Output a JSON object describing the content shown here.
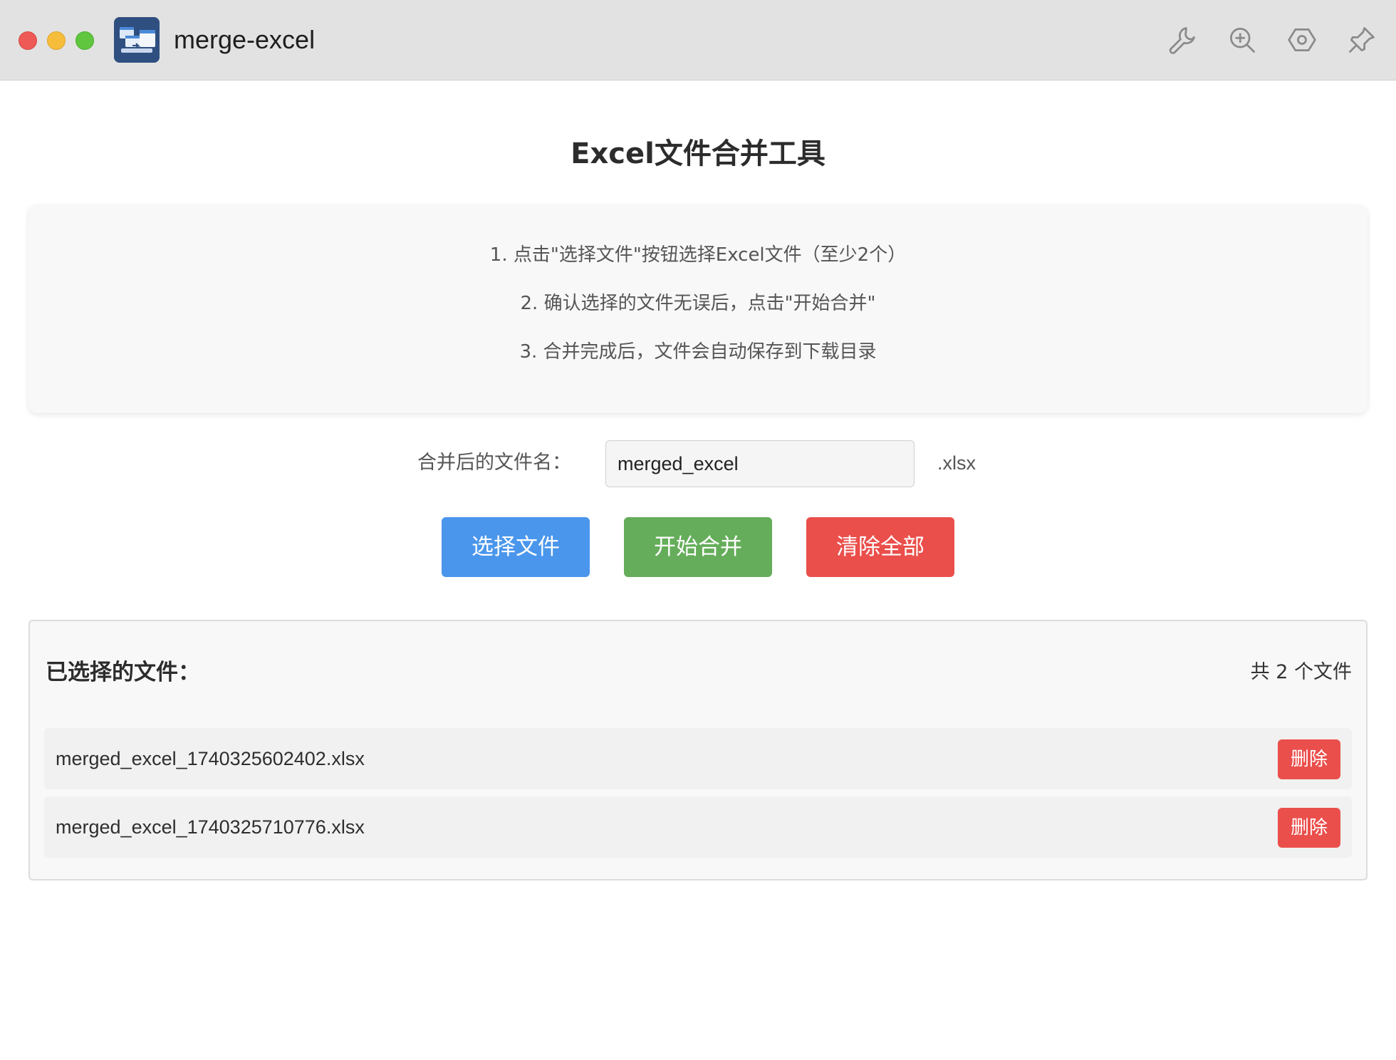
{
  "window": {
    "app_title": "merge-excel"
  },
  "main": {
    "page_title": "Excel文件合并工具",
    "instructions": [
      "1. 点击\"选择文件\"按钮选择Excel文件（至少2个）",
      "2. 确认选择的文件无误后，点击\"开始合并\"",
      "3. 合并完成后，文件会自动保存到下载目录"
    ],
    "filename": {
      "label": "合并后的文件名：",
      "value": "merged_excel",
      "extension": ".xlsx"
    },
    "buttons": {
      "select": "选择文件",
      "merge": "开始合并",
      "clear": "清除全部"
    },
    "files": {
      "heading": "已选择的文件：",
      "count": "共 2 个文件",
      "items": [
        {
          "name": "merged_excel_1740325602402.xlsx",
          "delete_label": "删除"
        },
        {
          "name": "merged_excel_1740325710776.xlsx",
          "delete_label": "删除"
        }
      ]
    }
  },
  "colors": {
    "select_button": "#4a96ec",
    "merge_button": "#65ad5a",
    "clear_button": "#ea4f4b",
    "delete_button": "#ea4f4b"
  },
  "icons": {
    "titlebar": [
      "wrench-icon",
      "zoom-in-icon",
      "hexagon-settings-icon",
      "pin-icon"
    ]
  }
}
